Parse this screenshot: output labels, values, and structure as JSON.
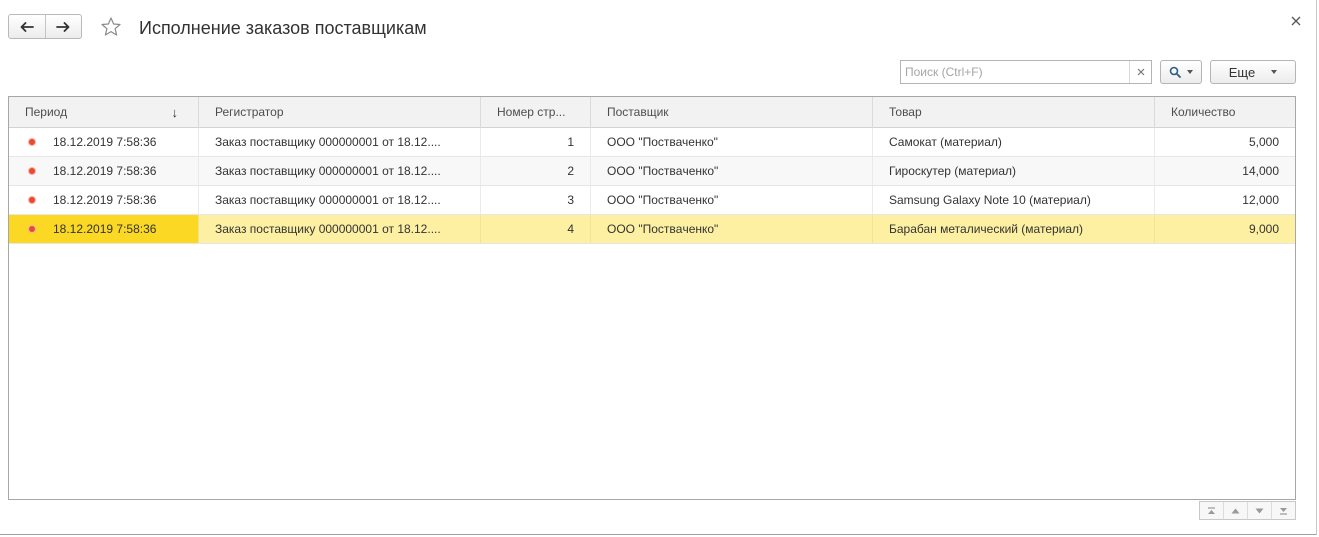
{
  "header": {
    "title": "Исполнение заказов поставщикам",
    "back_icon": "arrow-left-icon",
    "forward_icon": "arrow-right-icon",
    "favorite_icon": "star-icon",
    "close_icon": "close-icon"
  },
  "toolbar": {
    "search_placeholder": "Поиск (Ctrl+F)",
    "search_value": "",
    "clear_icon": "clear-icon",
    "search_icon": "magnifier-icon",
    "more_label": "Еще"
  },
  "table": {
    "columns": [
      {
        "label": "Период",
        "sorted": "desc"
      },
      {
        "label": "Регистратор"
      },
      {
        "label": "Номер стр..."
      },
      {
        "label": "Поставщик"
      },
      {
        "label": "Товар"
      },
      {
        "label": "Количество"
      }
    ],
    "rows": [
      {
        "period": "18.12.2019 7:58:36",
        "registrar": "Заказ поставщику 000000001 от 18.12....",
        "line": "1",
        "supplier": "ООО \"Постваченко\"",
        "item": "Самокат (материал)",
        "qty": "5,000"
      },
      {
        "period": "18.12.2019 7:58:36",
        "registrar": "Заказ поставщику 000000001 от 18.12....",
        "line": "2",
        "supplier": "ООО \"Поствaченко\"",
        "item": "Гироскутер (материал)",
        "qty": "14,000"
      },
      {
        "period": "18.12.2019 7:58:36",
        "registrar": "Заказ поставщику 000000001 от 18.12....",
        "line": "3",
        "supplier": "ООО \"Поствaченко\"",
        "item": "Samsung Galaxy Note 10 (материал)",
        "qty": "12,000"
      },
      {
        "period": "18.12.2019 7:58:36",
        "registrar": "Заказ поставщику 000000001 от 18.12....",
        "line": "4",
        "supplier": "ООО \"Поствaченко\"",
        "item": "Барабан металический (материал)",
        "qty": "9,000"
      }
    ],
    "selected_row": 3,
    "sort_arrow": "↓"
  },
  "colors": {
    "selected_row": "#fdf0a3",
    "selected_cell": "#fad823",
    "status_dot": "#ec4a2f"
  }
}
